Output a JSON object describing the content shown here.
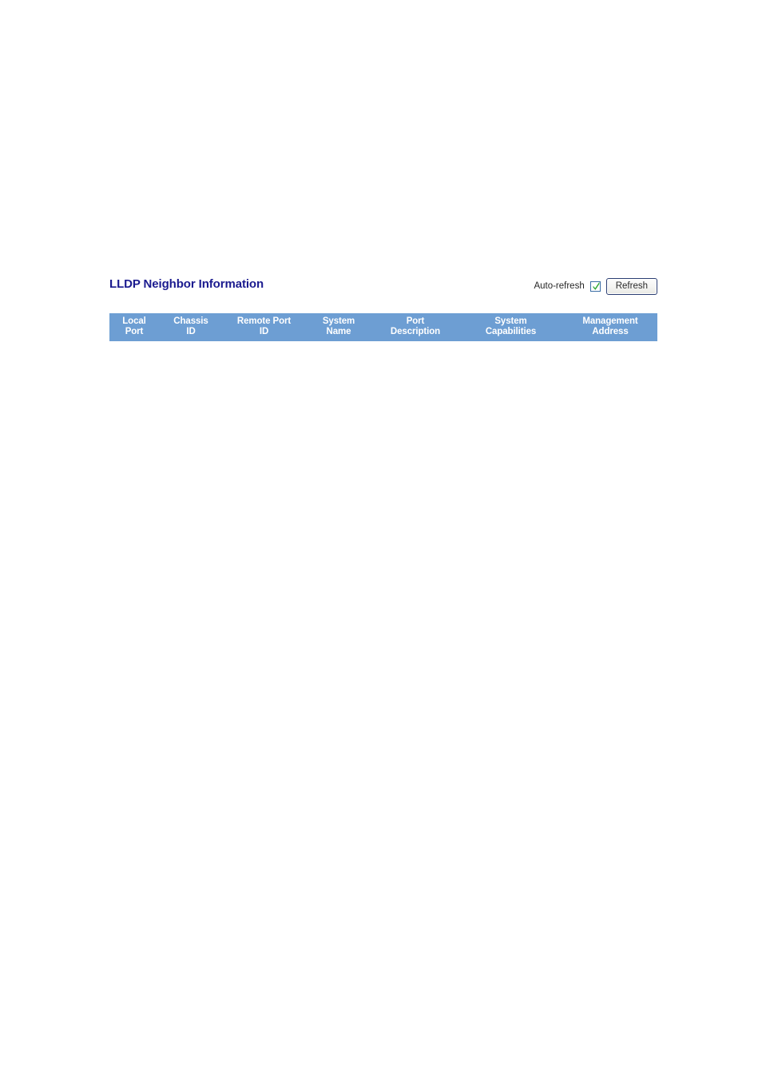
{
  "page": {
    "title": "LLDP Neighbor Information"
  },
  "controls": {
    "auto_refresh_label": "Auto-refresh",
    "auto_refresh_checked": true,
    "refresh_label": "Refresh"
  },
  "table": {
    "columns": [
      {
        "line1": "Local",
        "line2": "Port"
      },
      {
        "line1": "Chassis",
        "line2": "ID"
      },
      {
        "line1": "Remote Port",
        "line2": "ID"
      },
      {
        "line1": "System",
        "line2": "Name"
      },
      {
        "line1": "Port",
        "line2": "Description"
      },
      {
        "line1": "System",
        "line2": "Capabilities"
      },
      {
        "line1": "Management",
        "line2": "Address"
      }
    ],
    "rows": []
  },
  "colors": {
    "title": "#1b1b8f",
    "header_bg": "#6d9ed3",
    "header_text": "#ffffff",
    "checkbox_border": "#3b6ea5",
    "checkbox_tick": "#2fa832",
    "button_border": "#2c3f73",
    "page_bg": "#ffffff"
  }
}
